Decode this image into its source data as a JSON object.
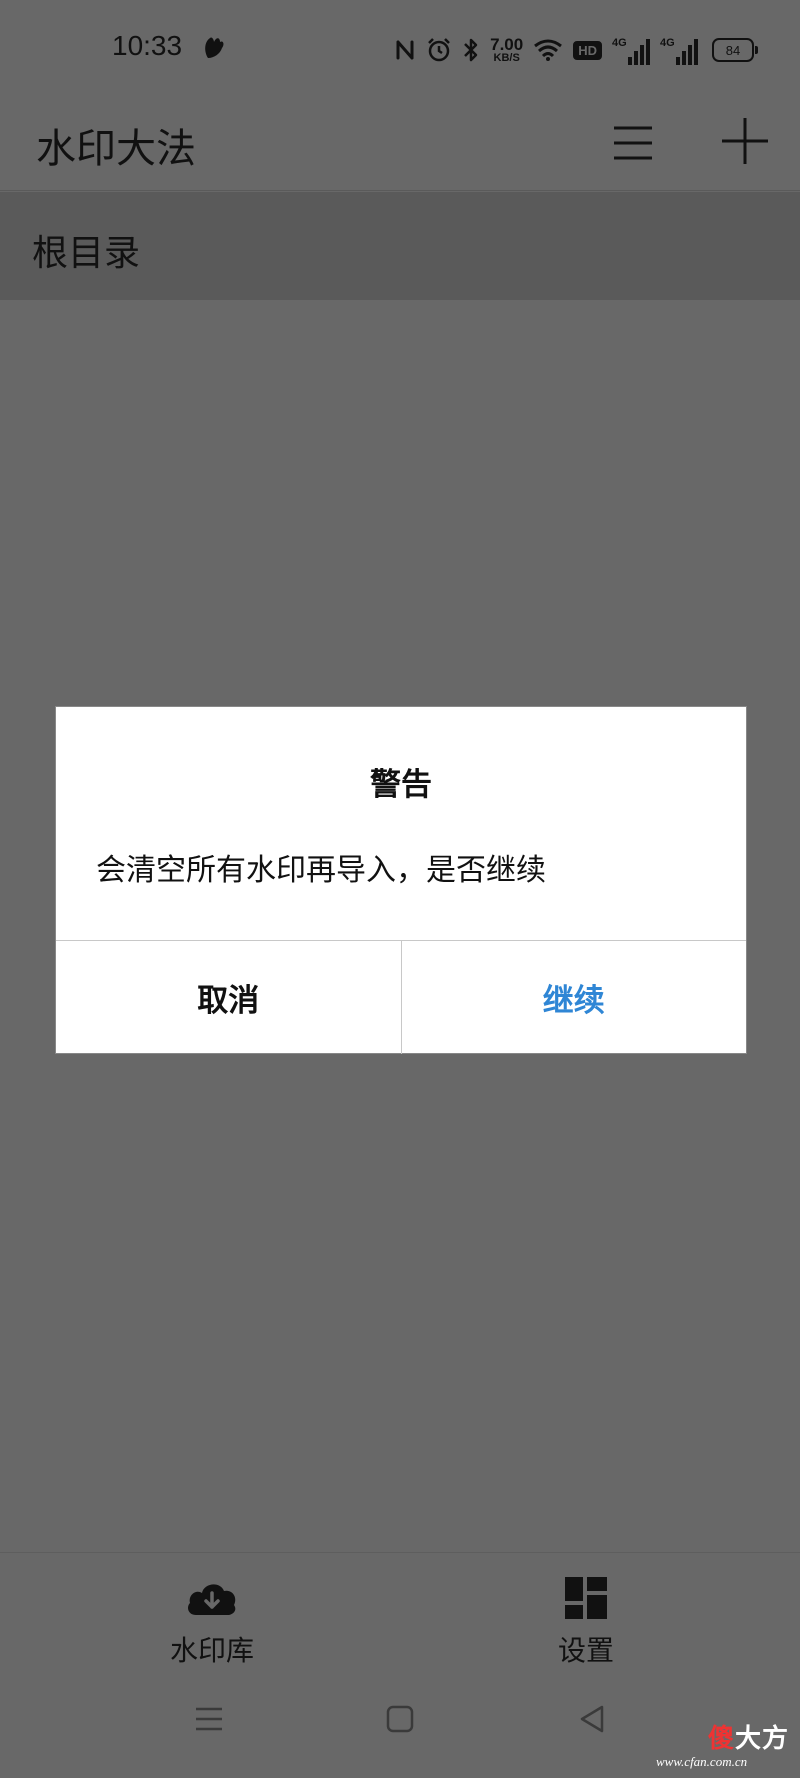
{
  "status_bar": {
    "time": "10:33",
    "net_speed_value": "7.00",
    "net_speed_unit": "KB/S",
    "hd_label": "HD",
    "signal1_label": "4G",
    "signal2_label": "4G",
    "battery_level": "84",
    "icons": [
      "app-notification-icon",
      "nfc-icon",
      "alarm-icon",
      "bluetooth-icon",
      "wifi-icon",
      "hd-icon",
      "signal-icon",
      "signal-icon",
      "battery-icon"
    ]
  },
  "app_bar": {
    "title": "水印大法",
    "menu_icon": "menu-icon",
    "add_icon": "plus-icon"
  },
  "breadcrumb": {
    "label": "根目录"
  },
  "dialog": {
    "title": "警告",
    "message": "会清空所有水印再导入，是否继续",
    "cancel_label": "取消",
    "confirm_label": "继续",
    "confirm_color": "#2f86d5"
  },
  "bottom_nav": {
    "items": [
      {
        "label": "水印库",
        "icon": "cloud-download-icon"
      },
      {
        "label": "设置",
        "icon": "dashboard-icon"
      }
    ]
  },
  "system_nav": {
    "icons": [
      "recents-icon",
      "home-icon",
      "back-icon"
    ]
  },
  "watermark": {
    "logo_accent": "傻",
    "logo_text": "大方",
    "site": "www.cfan.com.cn"
  },
  "colors": {
    "overlay_background": "#686868",
    "breadcrumb_background": "#5a5a5a",
    "dialog_background": "#ffffff"
  }
}
